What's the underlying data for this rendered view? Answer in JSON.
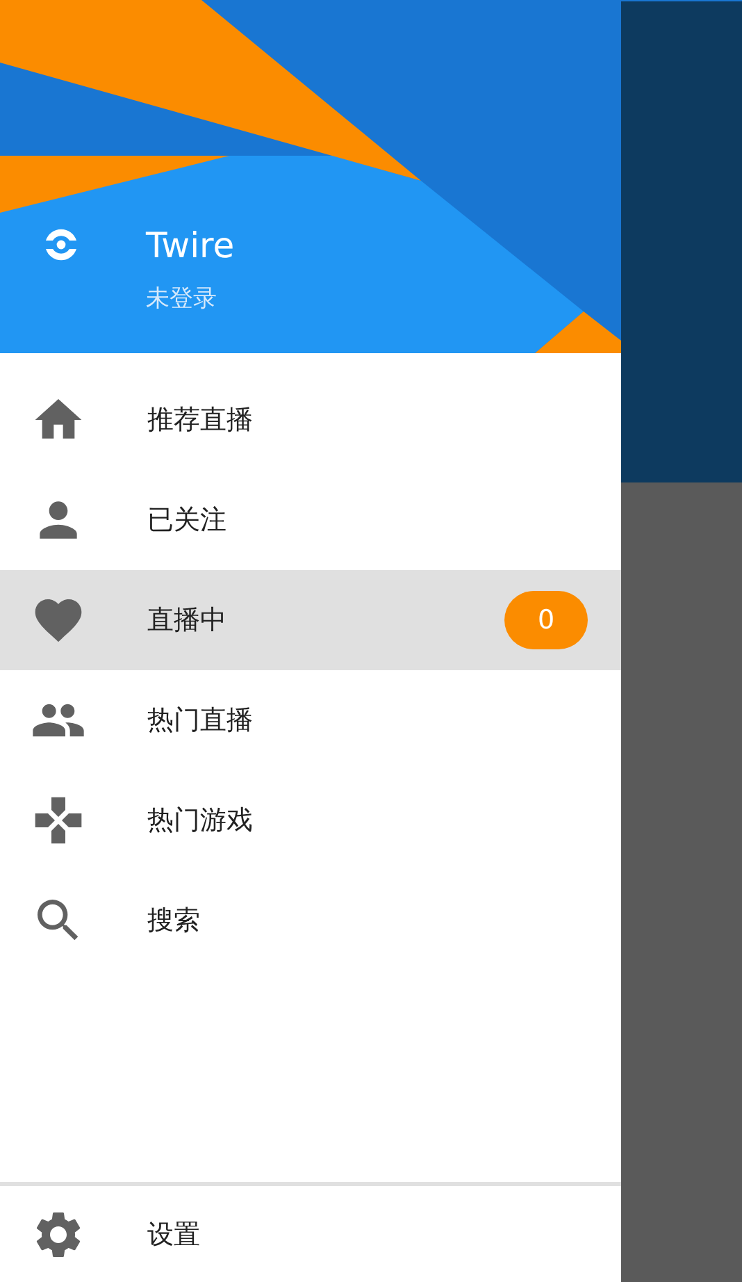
{
  "header": {
    "app_name": "Twire",
    "account_status": "未登录"
  },
  "menu": [
    {
      "label": "推荐直播",
      "selected": false
    },
    {
      "label": "已关注",
      "selected": false
    },
    {
      "label": "直播中",
      "selected": true,
      "badge": "0"
    },
    {
      "label": "热门直播",
      "selected": false
    },
    {
      "label": "热门游戏",
      "selected": false
    },
    {
      "label": "搜索",
      "selected": false
    }
  ],
  "footer": {
    "label": "设置"
  }
}
